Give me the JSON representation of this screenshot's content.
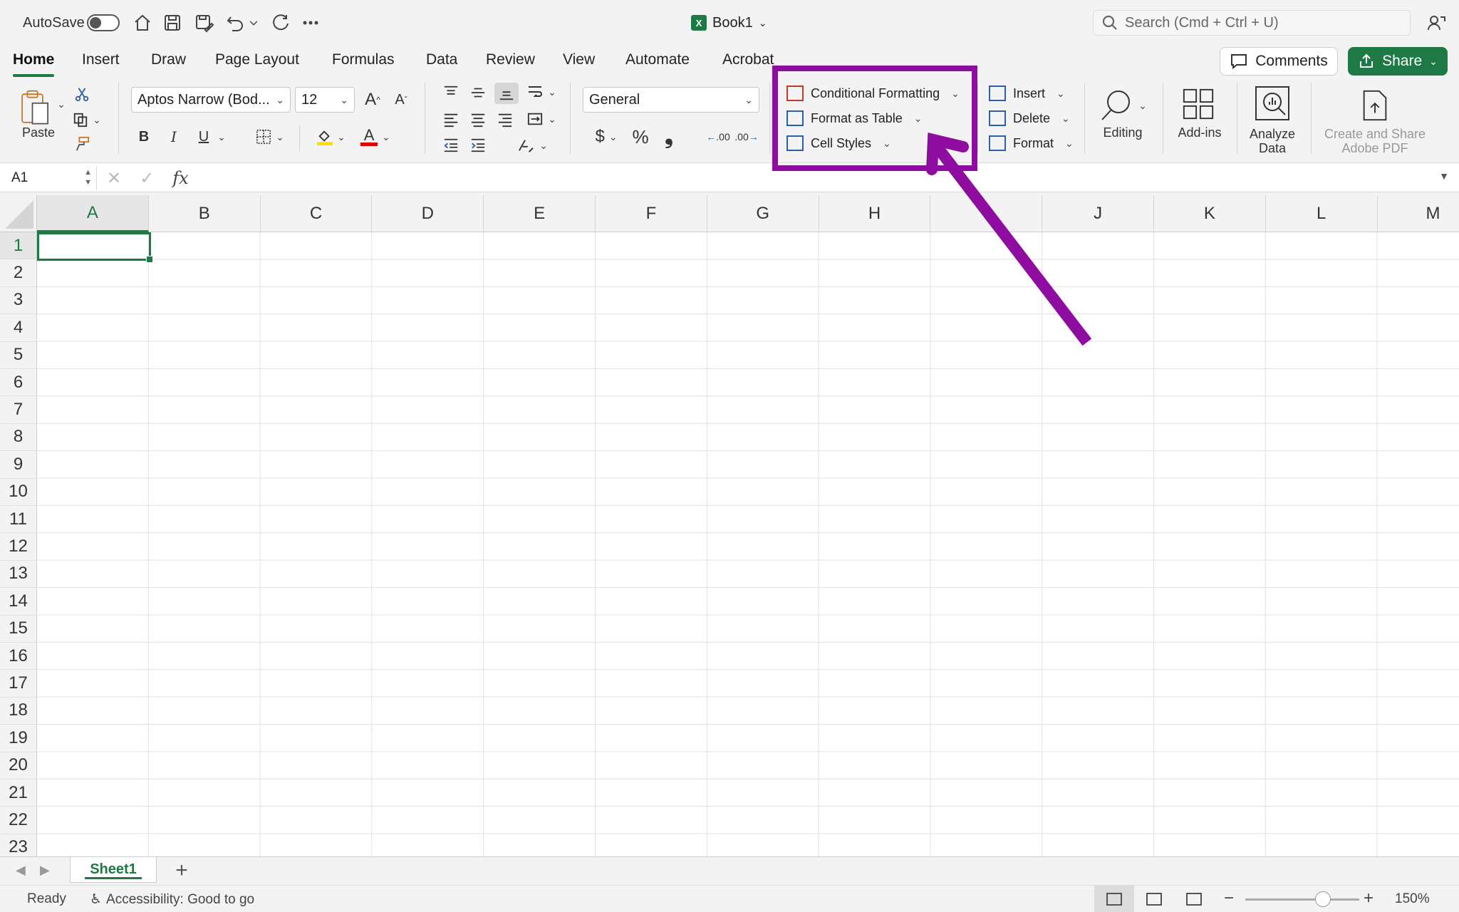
{
  "titlebar": {
    "autosave_label": "AutoSave",
    "doc_title": "Book1",
    "search_placeholder": "Search (Cmd + Ctrl + U)"
  },
  "tabs": [
    {
      "label": "Home",
      "active": true
    },
    {
      "label": "Insert"
    },
    {
      "label": "Draw"
    },
    {
      "label": "Page Layout"
    },
    {
      "label": "Formulas"
    },
    {
      "label": "Data"
    },
    {
      "label": "Review"
    },
    {
      "label": "View"
    },
    {
      "label": "Automate"
    },
    {
      "label": "Acrobat"
    }
  ],
  "header_buttons": {
    "comments": "Comments",
    "share": "Share"
  },
  "ribbon": {
    "paste_label": "Paste",
    "font_name": "Aptos Narrow (Bod...",
    "font_size": "12",
    "bold": "B",
    "italic": "I",
    "underline": "U",
    "number_format": "General",
    "currency": "$",
    "percent": "%",
    "styles": {
      "conditional_formatting": "Conditional Formatting",
      "format_as_table": "Format as Table",
      "cell_styles": "Cell Styles"
    },
    "cells": {
      "insert": "Insert",
      "delete": "Delete",
      "format": "Format"
    },
    "editing": "Editing",
    "add_ins": "Add-ins",
    "analyze_data": "Analyze\nData",
    "adobe_pdf": "Create and Share\nAdobe PDF"
  },
  "formula_bar": {
    "name_box": "A1",
    "fx": "fx",
    "value": ""
  },
  "grid": {
    "columns": [
      "A",
      "B",
      "C",
      "D",
      "E",
      "F",
      "G",
      "H",
      "I",
      "J",
      "K",
      "L",
      "M"
    ],
    "rows": [
      "1",
      "2",
      "3",
      "4",
      "5",
      "6",
      "7",
      "8",
      "9",
      "10",
      "11",
      "12",
      "13",
      "14",
      "15",
      "16",
      "17",
      "18",
      "19",
      "20",
      "21",
      "22",
      "23"
    ],
    "active_cell": "A1"
  },
  "sheets": [
    "Sheet1"
  ],
  "status": {
    "ready": "Ready",
    "accessibility": "Accessibility: Good to go",
    "zoom": "150%",
    "zoom_fraction": 0.68
  },
  "colors": {
    "accent": "#1d7a45",
    "annotation": "#8e0c9f"
  }
}
